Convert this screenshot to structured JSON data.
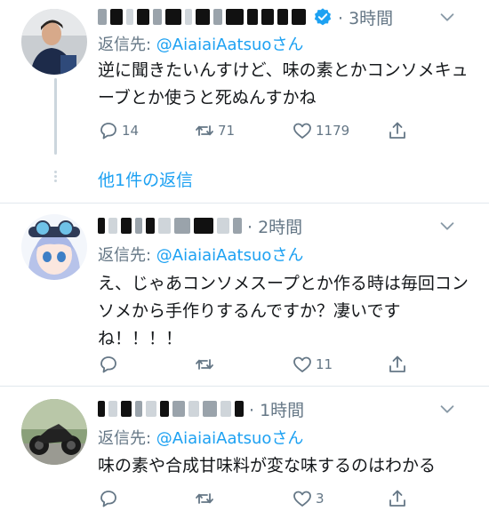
{
  "tweets": [
    {
      "time": "3時間",
      "reply_prefix": "返信先: ",
      "reply_mention": "@AiaiaiAatsuoさん",
      "body": "逆に聞きたいんすけど、味の素とかコンソメキューブとか使うと死ぬんすかね",
      "replies": "14",
      "retweets": "71",
      "likes": "1179",
      "more_replies_label": "他1件の返信"
    },
    {
      "time": "2時間",
      "reply_prefix": "返信先: ",
      "reply_mention": "@AiaiaiAatsuoさん",
      "body": "え、じゃあコンソメスープとか作る時は毎回コンソメから手作りするんですか？凄いですね！！！！",
      "replies": "",
      "retweets": "",
      "likes": "11"
    },
    {
      "time": "1時間",
      "reply_prefix": "返信先: ",
      "reply_mention": "@AiaiaiAatsuoさん",
      "body": "味の素や合成甘味料が変な味するのはわかる",
      "replies": "",
      "retweets": "",
      "likes": "3"
    }
  ],
  "colors": {
    "accent": "#1da1f2",
    "muted": "#657786",
    "text": "#14171a",
    "divider": "#e1e8ed"
  },
  "icons": [
    "reply-icon",
    "retweet-icon",
    "like-icon",
    "share-icon",
    "chevron-down-icon",
    "verified-badge-icon"
  ]
}
